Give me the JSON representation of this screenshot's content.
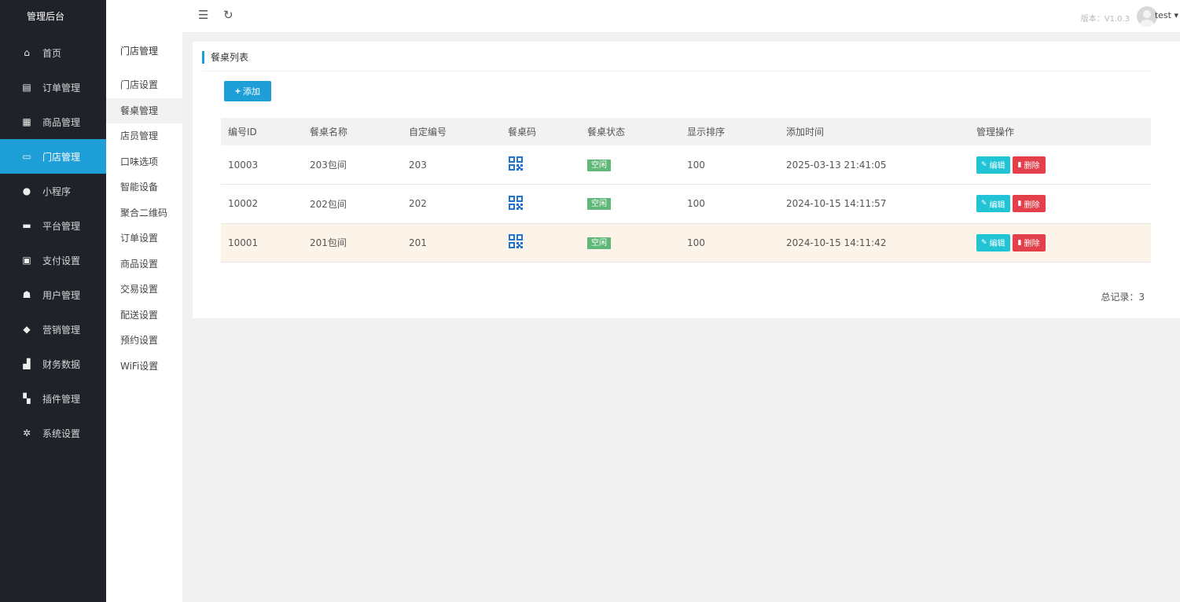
{
  "brand": "管理后台",
  "nav": [
    {
      "label": "首页",
      "icon": "home-icon",
      "glyph": "⌂"
    },
    {
      "label": "订单管理",
      "icon": "order-icon",
      "glyph": "▤"
    },
    {
      "label": "商品管理",
      "icon": "goods-icon",
      "glyph": "▦"
    },
    {
      "label": "门店管理",
      "icon": "store-icon",
      "glyph": "▭"
    },
    {
      "label": "小程序",
      "icon": "miniapp-icon",
      "glyph": "●"
    },
    {
      "label": "平台管理",
      "icon": "platform-icon",
      "glyph": "▬"
    },
    {
      "label": "支付设置",
      "icon": "payment-icon",
      "glyph": "▣"
    },
    {
      "label": "用户管理",
      "icon": "user-icon",
      "glyph": "☗"
    },
    {
      "label": "营销管理",
      "icon": "tag-icon",
      "glyph": "◆"
    },
    {
      "label": "财务数据",
      "icon": "chart-icon",
      "glyph": "▟"
    },
    {
      "label": "插件管理",
      "icon": "plugin-icon",
      "glyph": "▚"
    },
    {
      "label": "系统设置",
      "icon": "gear-icon",
      "glyph": "✲"
    }
  ],
  "submenu": {
    "title": "门店管理",
    "items": [
      "门店设置",
      "餐桌管理",
      "店员管理",
      "口味选项",
      "智能设备",
      "聚合二维码",
      "订单设置",
      "商品设置",
      "交易设置",
      "配送设置",
      "预约设置",
      "WiFi设置"
    ]
  },
  "topbar": {
    "version": "版本：V1.0.3",
    "username": "test"
  },
  "panel": {
    "title": "餐桌列表",
    "add_label": "添加",
    "columns": [
      "编号ID",
      "餐桌名称",
      "自定编号",
      "餐桌码",
      "餐桌状态",
      "显示排序",
      "添加时间",
      "管理操作"
    ],
    "rows": [
      {
        "id": "10003",
        "name": "203包间",
        "code": "203",
        "status": "空闲",
        "sort": "100",
        "time": "2025-03-13 21:41:05"
      },
      {
        "id": "10002",
        "name": "202包间",
        "code": "202",
        "status": "空闲",
        "sort": "100",
        "time": "2024-10-15 14:11:57"
      },
      {
        "id": "10001",
        "name": "201包间",
        "code": "201",
        "status": "空闲",
        "sort": "100",
        "time": "2024-10-15 14:11:42"
      }
    ],
    "edit_label": "编辑",
    "delete_label": "删除",
    "total": "总记录：3"
  },
  "colors": {
    "sidebar_bg": "#20222a",
    "accent": "#1e9fd8",
    "status_free": "#5fb878",
    "edit": "#20c4d4",
    "delete": "#e4404b"
  }
}
